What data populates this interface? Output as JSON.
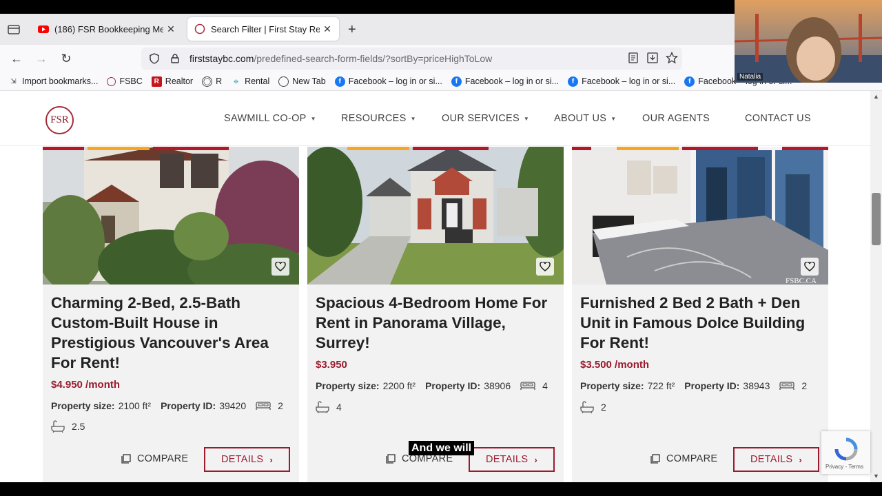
{
  "browser": {
    "tabs": [
      {
        "title": "(186) FSR Bookkeeping Meeting",
        "active": false
      },
      {
        "title": "Search Filter | First Stay Realty In",
        "active": true
      }
    ],
    "url_host": "firststaybc.com",
    "url_path": "/predefined-search-form-fields/?sortBy=priceHighToLow",
    "bookmarks": [
      {
        "label": "Import bookmarks...",
        "icon": "import-icon"
      },
      {
        "label": "FSBC",
        "icon": "fsbc-icon"
      },
      {
        "label": "Realtor",
        "icon": "realtor-icon"
      },
      {
        "label": "R",
        "icon": "globe-icon"
      },
      {
        "label": "Rental",
        "icon": "map-pin-icon"
      },
      {
        "label": "New Tab",
        "icon": "globe-icon"
      },
      {
        "label": "Facebook – log in or si...",
        "icon": "facebook-icon"
      },
      {
        "label": "Facebook – log in or si...",
        "icon": "facebook-icon"
      },
      {
        "label": "Facebook – log in or si...",
        "icon": "facebook-icon"
      },
      {
        "label": "Facebook – log in or si...",
        "icon": "facebook-icon"
      }
    ]
  },
  "site": {
    "logo": "FSR",
    "menu": [
      {
        "label": "SAWMILL CO-OP",
        "dropdown": true
      },
      {
        "label": "RESOURCES",
        "dropdown": true
      },
      {
        "label": "OUR SERVICES",
        "dropdown": true
      },
      {
        "label": "ABOUT US",
        "dropdown": true
      },
      {
        "label": "OUR AGENTS",
        "dropdown": false
      },
      {
        "label": "CONTACT US",
        "dropdown": false
      }
    ]
  },
  "listings": [
    {
      "title": "Charming 2-Bed, 2.5-Bath Custom-Built House in Prestigious Vancouver's Area For Rent!",
      "price": "$4.950 /month",
      "size_label": "Property size:",
      "size": "2100 ft²",
      "id_label": "Property ID:",
      "id": "39420",
      "beds": "2",
      "baths": "2.5"
    },
    {
      "title": "Spacious 4-Bedroom Home For Rent in Panorama Village, Surrey!",
      "price": "$3.950",
      "size_label": "Property size:",
      "size": "2200 ft²",
      "id_label": "Property ID:",
      "id": "38906",
      "beds": "4",
      "baths": "4"
    },
    {
      "title": "Furnished 2 Bed 2 Bath + Den Unit in Famous Dolce Building For Rent!",
      "price": "$3.500 /month",
      "size_label": "Property size:",
      "size": "722 ft²",
      "id_label": "Property ID:",
      "id": "38943",
      "beds": "2",
      "baths": "2"
    }
  ],
  "buttons": {
    "compare": "COMPARE",
    "details": "DETAILS"
  },
  "caption": "And we will",
  "watermark": "FSBC.CA",
  "recaptcha": "Privacy - Terms",
  "webcam_name": "Natalia",
  "colors": {
    "brand": "#9b1b2e",
    "stripe_orange": "#f5a623",
    "stripe_red": "#b0182c"
  }
}
